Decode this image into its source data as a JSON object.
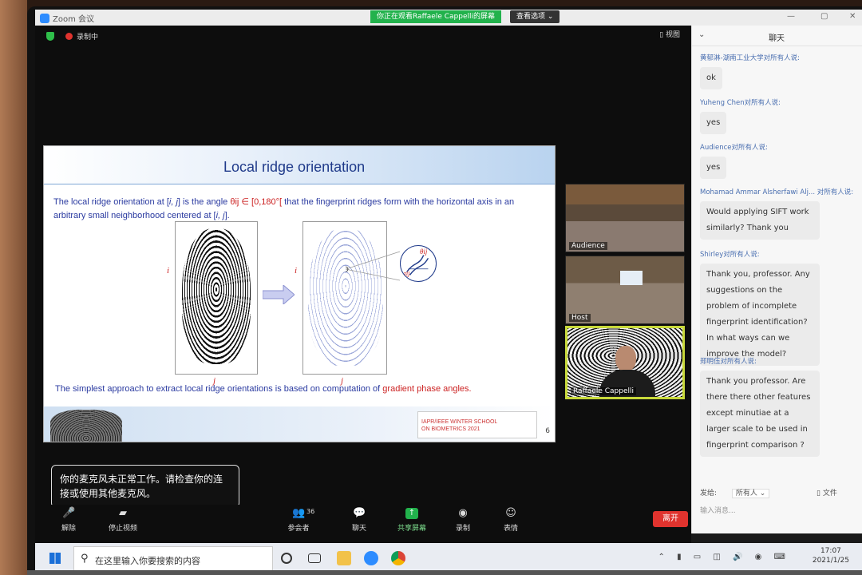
{
  "window": {
    "app_title": "Zoom 会议",
    "viewing_banner": "你正在观看Raffaele Cappelli的屏幕",
    "view_options": "查看选项 ⌄",
    "view_button": "▯ 视图"
  },
  "status": {
    "recording_label": "录制中"
  },
  "slide": {
    "title": "Local ridge orientation",
    "desc_part1": "The local ridge orientation at [",
    "desc_var1": "i, j",
    "desc_part2": "] is the angle ",
    "desc_theta": "θij ∈ [0,180°[",
    "desc_part3": " that the fingerprint ridges form with the horizontal axis in an arbitrary small neighborhood centered at [",
    "desc_var2": "i, j",
    "desc_part4": "].",
    "label_i": "i",
    "label_j": "j",
    "theta_label": "θij",
    "tau_label": "τij",
    "footer_text": "The simplest approach to extract local ridge orientations is based on computation of ",
    "footer_red": "gradient phase angles.",
    "school_text": "IAPR/IEEE WINTER SCHOOL\nON BIOMETRICS 2021",
    "page_number": "6"
  },
  "videos": [
    {
      "name": "Audience"
    },
    {
      "name": "Host"
    },
    {
      "name": "Raffaele Cappelli"
    }
  ],
  "notice": {
    "text": "你的麦克风未正常工作。请检查你的连接或使用其他麦克风。"
  },
  "toolbar": {
    "mic_label": "解除",
    "video_label": "停止视频",
    "participants_label": "参会者",
    "participants_count": "36",
    "chat_label": "聊天",
    "share_label": "共享屏幕",
    "record_label": "录制",
    "reactions_label": "表情",
    "leave_label": "离开"
  },
  "chat": {
    "title": "聊天",
    "messages": [
      {
        "from": "黄郁淋-湖南工业大学对所有人说:",
        "text": "ok"
      },
      {
        "from": "Yuheng Chen对所有人说:",
        "text": "yes"
      },
      {
        "from": "Audience对所有人说:",
        "text": "yes"
      },
      {
        "from": "Mohamad Ammar Alsherfawi Alj... 对所有人说:",
        "text": "Would applying SIFT work similarly? Thank you"
      },
      {
        "from": "Shirley对所有人说:",
        "text": "Thank you, professor. Any suggestions on the problem of incomplete fingerprint identification? In what ways can we improve the model?"
      },
      {
        "from": "郑明伍对所有人说:",
        "text": "Thank you professor. Are there there other features except minutiae at a larger scale to be used in fingerprint comparison ?"
      }
    ],
    "send_to_label": "发给:",
    "send_to_value": "所有人 ⌄",
    "file_label": "▯ 文件",
    "input_placeholder": "输入消息..."
  },
  "taskbar": {
    "search_placeholder": "在这里输入你要搜索的内容",
    "time": "17:07",
    "date": "2021/1/25"
  },
  "colors": {
    "zoom_blue": "#2d8cff",
    "green_banner": "#22b24c",
    "leave_red": "#e0332e",
    "slide_title_blue": "#1f3a8a",
    "active_speaker_border": "#c8d93b"
  }
}
